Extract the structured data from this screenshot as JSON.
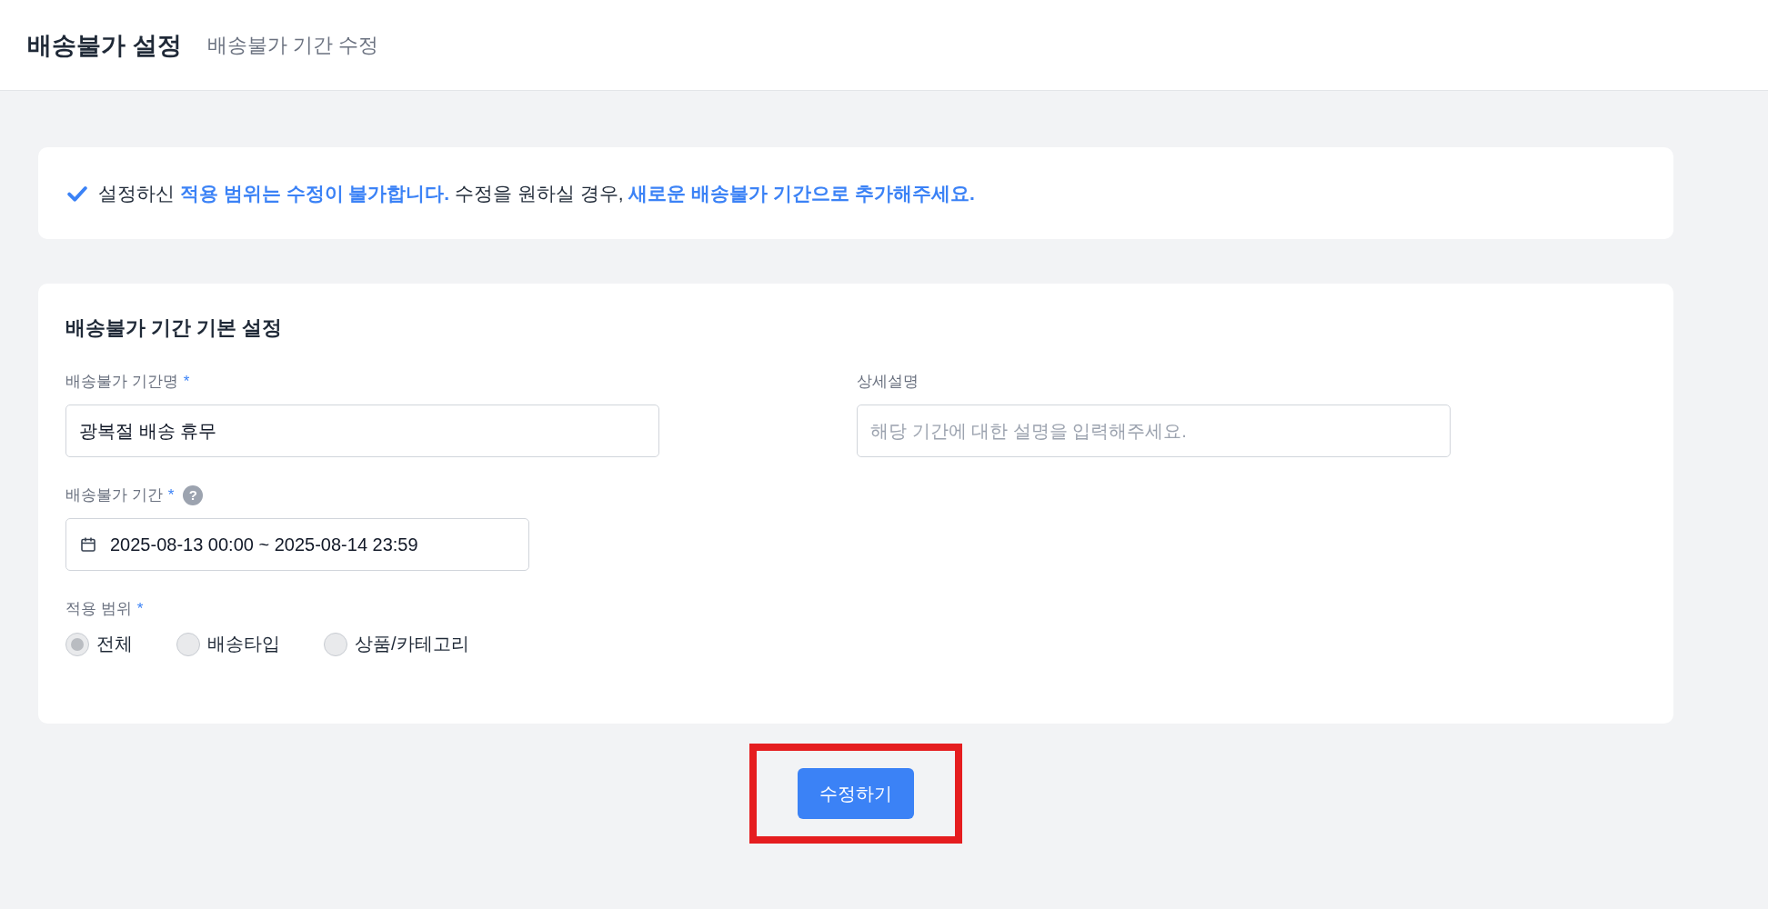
{
  "header": {
    "title": "배송불가 설정",
    "subtitle": "배송불가 기간 수정"
  },
  "notice": {
    "text": "설정하신 **적용 범위는 수정이 불가합니다.** 수정을 원하실 경우, **새로운 배송불가 기간으로 추가해주세요.**"
  },
  "form": {
    "title": "배송불가 기간 기본 설정",
    "name_field": {
      "label": "배송불가 기간명",
      "required_mark": "*",
      "value": "광복절 배송 휴무"
    },
    "description_field": {
      "label": "상세설명",
      "placeholder": "해당 기간에 대한 설명을 입력해주세요."
    },
    "period_field": {
      "label": "배송불가 기간",
      "required_mark": "*",
      "help_icon": "?",
      "value": "2025-08-13 00:00 ~ 2025-08-14 23:59"
    },
    "scope": {
      "label": "적용 범위",
      "required_mark": "*",
      "options": [
        {
          "label": "전체",
          "selected": true,
          "disabled": true
        },
        {
          "label": "배송타입",
          "selected": false,
          "disabled": true
        },
        {
          "label": "상품/카테고리",
          "selected": false,
          "disabled": true
        }
      ]
    }
  },
  "submit_button": {
    "label": "수정하기",
    "highlighted": true
  }
}
